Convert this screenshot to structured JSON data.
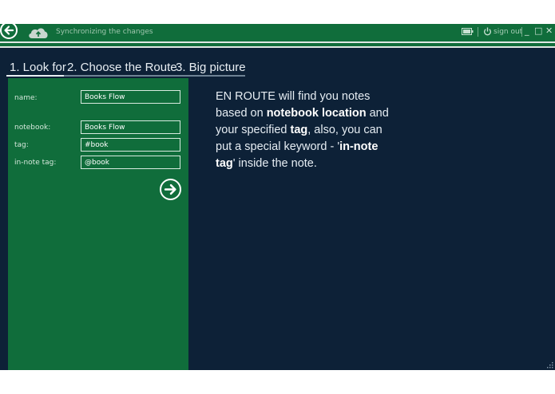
{
  "titlebar": {
    "sync_status": "Synchronizing the changes",
    "signout_label": "sign out",
    "minimize_label": "_",
    "maximize_label": "□",
    "close_label": "✕"
  },
  "tabs": [
    {
      "label": "1. Look for"
    },
    {
      "label": "2. Choose the Route"
    },
    {
      "label": "3. Big picture"
    }
  ],
  "form": {
    "name_label": "name:",
    "name_value": "Books Flow",
    "notebook_label": "notebook:",
    "notebook_value": "Books Flow",
    "tag_label": "tag:",
    "tag_value": "#book",
    "innote_label": "in-note tag:",
    "innote_value": "@book"
  },
  "description": {
    "p1": "EN ROUTE will find you notes based on ",
    "b1": "notebook location",
    "p2": " and your specified ",
    "b2": "tag",
    "p3": ", also, you can put a special keyword - '",
    "b3": "in-note tag",
    "p4": "' inside the note."
  },
  "colors": {
    "accent_green": "#106d3b",
    "background_navy": "#0d2137"
  }
}
